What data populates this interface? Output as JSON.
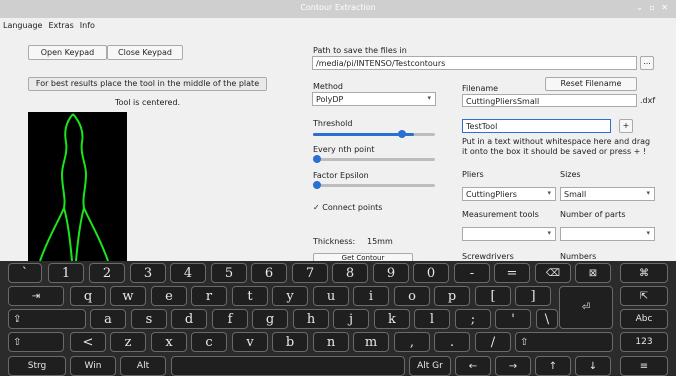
{
  "window": {
    "title": "Contour Extraction",
    "controls": "⌄ ▫ ✕"
  },
  "menu": [
    "Language",
    "Extras",
    "Info"
  ],
  "left": {
    "open_keypad": "Open Keypad",
    "close_keypad": "Close Keypad",
    "hint": "For best results place the tool in the middle of the plate",
    "status": "Tool is centered."
  },
  "path": {
    "label": "Path to save the files in",
    "value": "/media/pi/INTENSO/Testcontours",
    "browse": "..."
  },
  "method": {
    "label": "Method",
    "value": "PolyDP"
  },
  "threshold": {
    "label": "Threshold",
    "value": 0.83
  },
  "every_nth": {
    "label": "Every nth point",
    "value": 0.0
  },
  "epsilon": {
    "label": "Factor Epsilon",
    "value": 0.0
  },
  "connect": {
    "label": "Connect points",
    "checked": "✓"
  },
  "thickness": {
    "label": "Thickness:",
    "value": "15mm"
  },
  "get_contour": "Get Contour",
  "filename": {
    "label": "Filename",
    "reset": "Reset Filename",
    "value": "CuttingPliersSmall",
    "ext": ".dxf"
  },
  "tool_name": {
    "value": "TestTool",
    "add": "+",
    "help": "Put in a text without whitespace here and drag it onto the box it should be saved or press + !"
  },
  "pliers": {
    "label": "Pliers",
    "value": "CuttingPliers"
  },
  "sizes": {
    "label": "Sizes",
    "value": "Small"
  },
  "measurement": {
    "label": "Measurement tools",
    "value": ""
  },
  "num_parts": {
    "label": "Number of parts",
    "value": ""
  },
  "screwdrivers": {
    "label": "Screwdrivers"
  },
  "numbers": {
    "label": "Numbers"
  },
  "keyboard": {
    "row1": [
      "`",
      "1",
      "2",
      "3",
      "4",
      "5",
      "6",
      "7",
      "8",
      "9",
      "0",
      "-",
      "=",
      "⌫",
      "⊠",
      "⌘"
    ],
    "row2": [
      "⇥",
      "q",
      "w",
      "e",
      "r",
      "t",
      "y",
      "u",
      "i",
      "o",
      "p",
      "[",
      "]",
      "⏎",
      "⇱"
    ],
    "row3": [
      "⇪",
      "a",
      "s",
      "d",
      "f",
      "g",
      "h",
      "j",
      "k",
      "l",
      ";",
      "'",
      "\\",
      "Abc"
    ],
    "row4": [
      "⇧",
      "<",
      "z",
      "x",
      "c",
      "v",
      "b",
      "n",
      "m",
      ",",
      ".",
      "/",
      "⇧",
      "123"
    ],
    "row5": [
      "Strg",
      "Win",
      "Alt",
      "",
      "Alt Gr",
      "←",
      "→",
      "↑",
      "↓",
      "≡"
    ]
  },
  "colors": {
    "contour": "#19e619",
    "accent": "#2a6fd1",
    "keyboard_bg": "#2b2b2b"
  }
}
